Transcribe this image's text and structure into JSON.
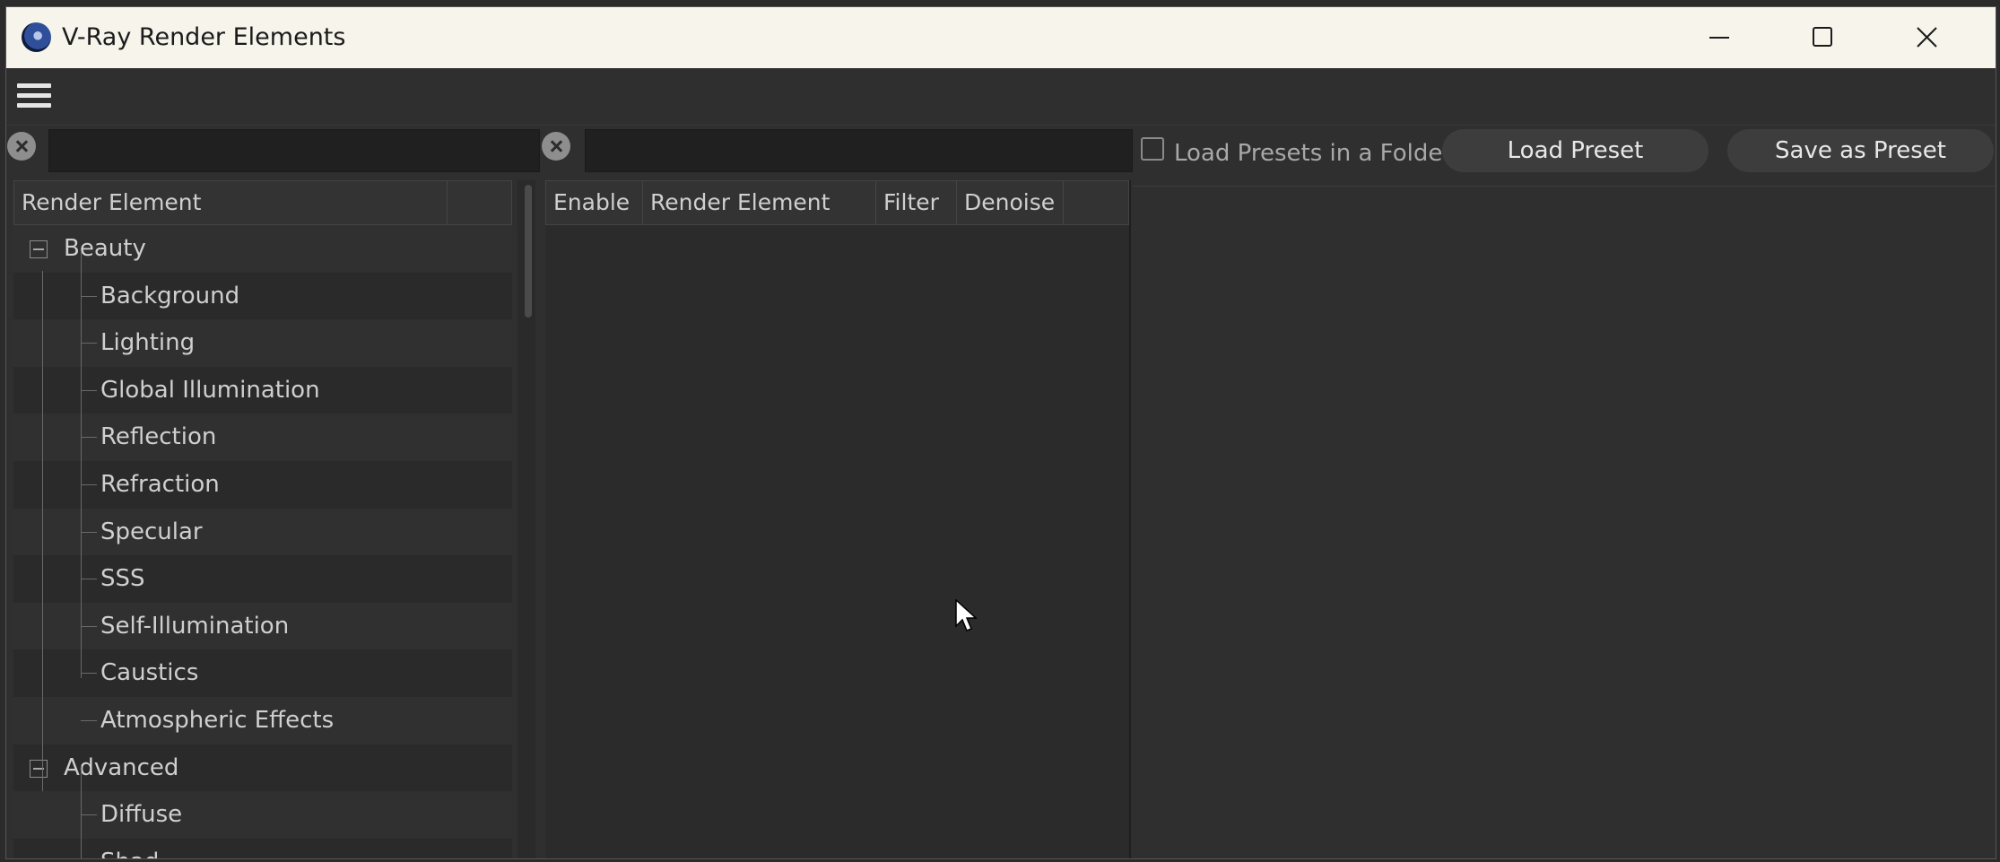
{
  "window": {
    "title": "V-Ray Render Elements",
    "controls": [
      "minimize-icon",
      "maximize-icon",
      "close-icon"
    ]
  },
  "menubar": {
    "icon": "hamburger-menu-icon"
  },
  "left_search": {
    "value": "",
    "clear_icon": "clear-search-icon"
  },
  "middle_search": {
    "value": "",
    "clear_icon": "clear-search-icon"
  },
  "presets": {
    "load_in_folder_label": "Load Presets in a Folder",
    "load_in_folder_checked": false,
    "load_button": "Load Preset",
    "save_button": "Save as Preset"
  },
  "tree": {
    "header": "Render Element",
    "groups": [
      {
        "label": "Beauty",
        "expanded": true,
        "items": [
          "Background",
          "Lighting",
          "Global Illumination",
          "Reflection",
          "Refraction",
          "Specular",
          "SSS",
          "Self-Illumination",
          "Caustics",
          "Atmospheric Effects"
        ]
      },
      {
        "label": "Advanced",
        "expanded": true,
        "items": [
          "Diffuse",
          "Shad..."
        ]
      }
    ]
  },
  "elements_table": {
    "columns": [
      "Enable",
      "Render Element",
      "Filter",
      "Denoise"
    ],
    "rows": []
  },
  "colors": {
    "title_bar": "#f7f4ec",
    "panel_bg": "#2f2f2f",
    "button_bg": "#3d3d3d"
  }
}
